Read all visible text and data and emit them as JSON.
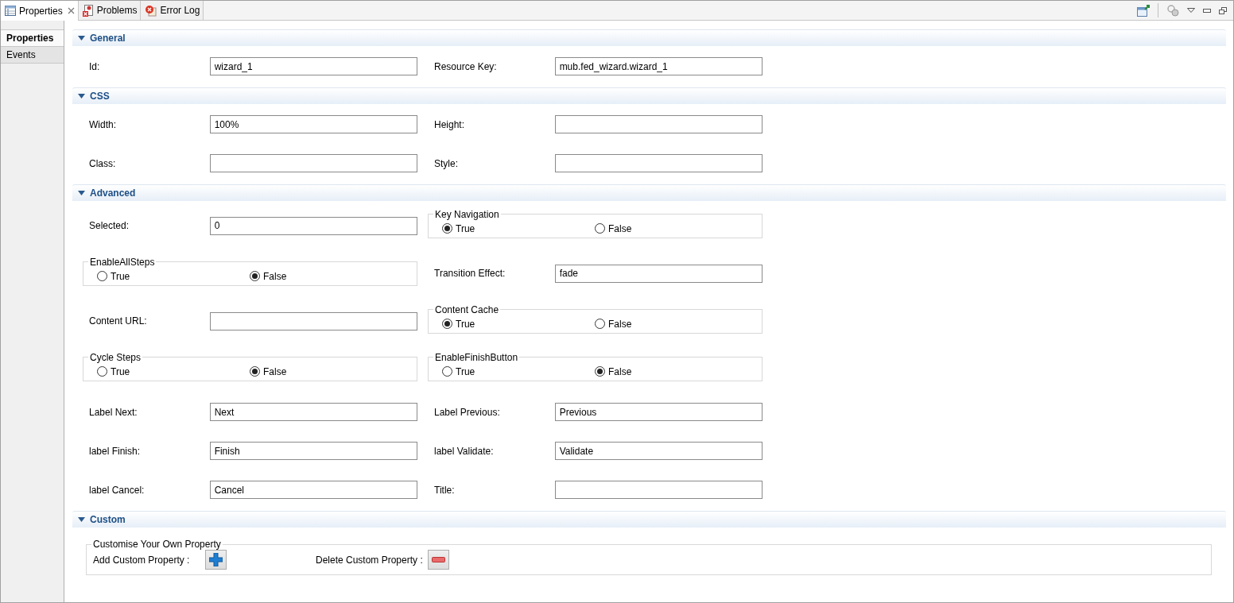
{
  "tabs": [
    {
      "label": "Properties",
      "selected": true,
      "closable": true
    },
    {
      "label": "Problems",
      "selected": false,
      "closable": false
    },
    {
      "label": "Error Log",
      "selected": false,
      "closable": false
    }
  ],
  "sidebar": {
    "items": [
      {
        "label": "Properties",
        "selected": true
      },
      {
        "label": "Events",
        "selected": false
      }
    ]
  },
  "sections": [
    {
      "title": "General",
      "expanded": true,
      "rows": [
        [
          {
            "kind": "field",
            "label": "Id:",
            "value": "wizard_1"
          },
          {
            "kind": "field",
            "label": "Resource Key:",
            "value": "mub.fed_wizard.wizard_1"
          }
        ]
      ]
    },
    {
      "title": "CSS",
      "expanded": true,
      "rows": [
        [
          {
            "kind": "field",
            "label": "Width:",
            "value": "100%"
          },
          {
            "kind": "field",
            "label": "Height:"
          }
        ],
        [
          {
            "kind": "field",
            "label": "Class:"
          },
          {
            "kind": "field",
            "label": "Style:"
          }
        ]
      ]
    },
    {
      "title": "Advanced",
      "expanded": true,
      "rows": [
        [
          {
            "kind": "field",
            "label": "Selected:",
            "value": "0"
          },
          {
            "kind": "radio-group",
            "legend": "Key Navigation",
            "options": [
              {
                "label": "True",
                "selected": true
              },
              {
                "label": "False",
                "selected": false
              }
            ]
          }
        ],
        [
          {
            "kind": "radio-group",
            "legend": "EnableAllSteps",
            "options": [
              {
                "label": "True",
                "selected": false
              },
              {
                "label": "False",
                "selected": true
              }
            ]
          },
          {
            "kind": "field",
            "label": "Transition Effect:",
            "value": "fade"
          }
        ],
        [
          {
            "kind": "field",
            "label": "Content URL:"
          },
          {
            "kind": "radio-group",
            "legend": "Content Cache",
            "options": [
              {
                "label": "True",
                "selected": true
              },
              {
                "label": "False",
                "selected": false
              }
            ]
          }
        ],
        [
          {
            "kind": "radio-group",
            "legend": "Cycle Steps",
            "options": [
              {
                "label": "True",
                "selected": false
              },
              {
                "label": "False",
                "selected": true
              }
            ]
          },
          {
            "kind": "radio-group",
            "legend": "EnableFinishButton",
            "options": [
              {
                "label": "True",
                "selected": false
              },
              {
                "label": "False",
                "selected": true
              }
            ]
          }
        ],
        [
          {
            "kind": "field",
            "label": "Label Next:",
            "value": "Next"
          },
          {
            "kind": "field",
            "label": "Label Previous:",
            "value": "Previous"
          }
        ],
        [
          {
            "kind": "field",
            "label": "label Finish:",
            "value": "Finish"
          },
          {
            "kind": "field",
            "label": "label Validate:",
            "value": "Validate"
          }
        ],
        [
          {
            "kind": "field",
            "label": "label Cancel:",
            "value": "Cancel"
          },
          {
            "kind": "field",
            "label": "Title:"
          }
        ]
      ]
    },
    {
      "title": "Custom",
      "expanded": true,
      "group": {
        "legend": "Customise Your Own Property",
        "actions": [
          {
            "kind": "add",
            "label": "Add Custom Property :"
          },
          {
            "kind": "remove",
            "label": "Delete Custom Property :"
          }
        ]
      }
    }
  ]
}
